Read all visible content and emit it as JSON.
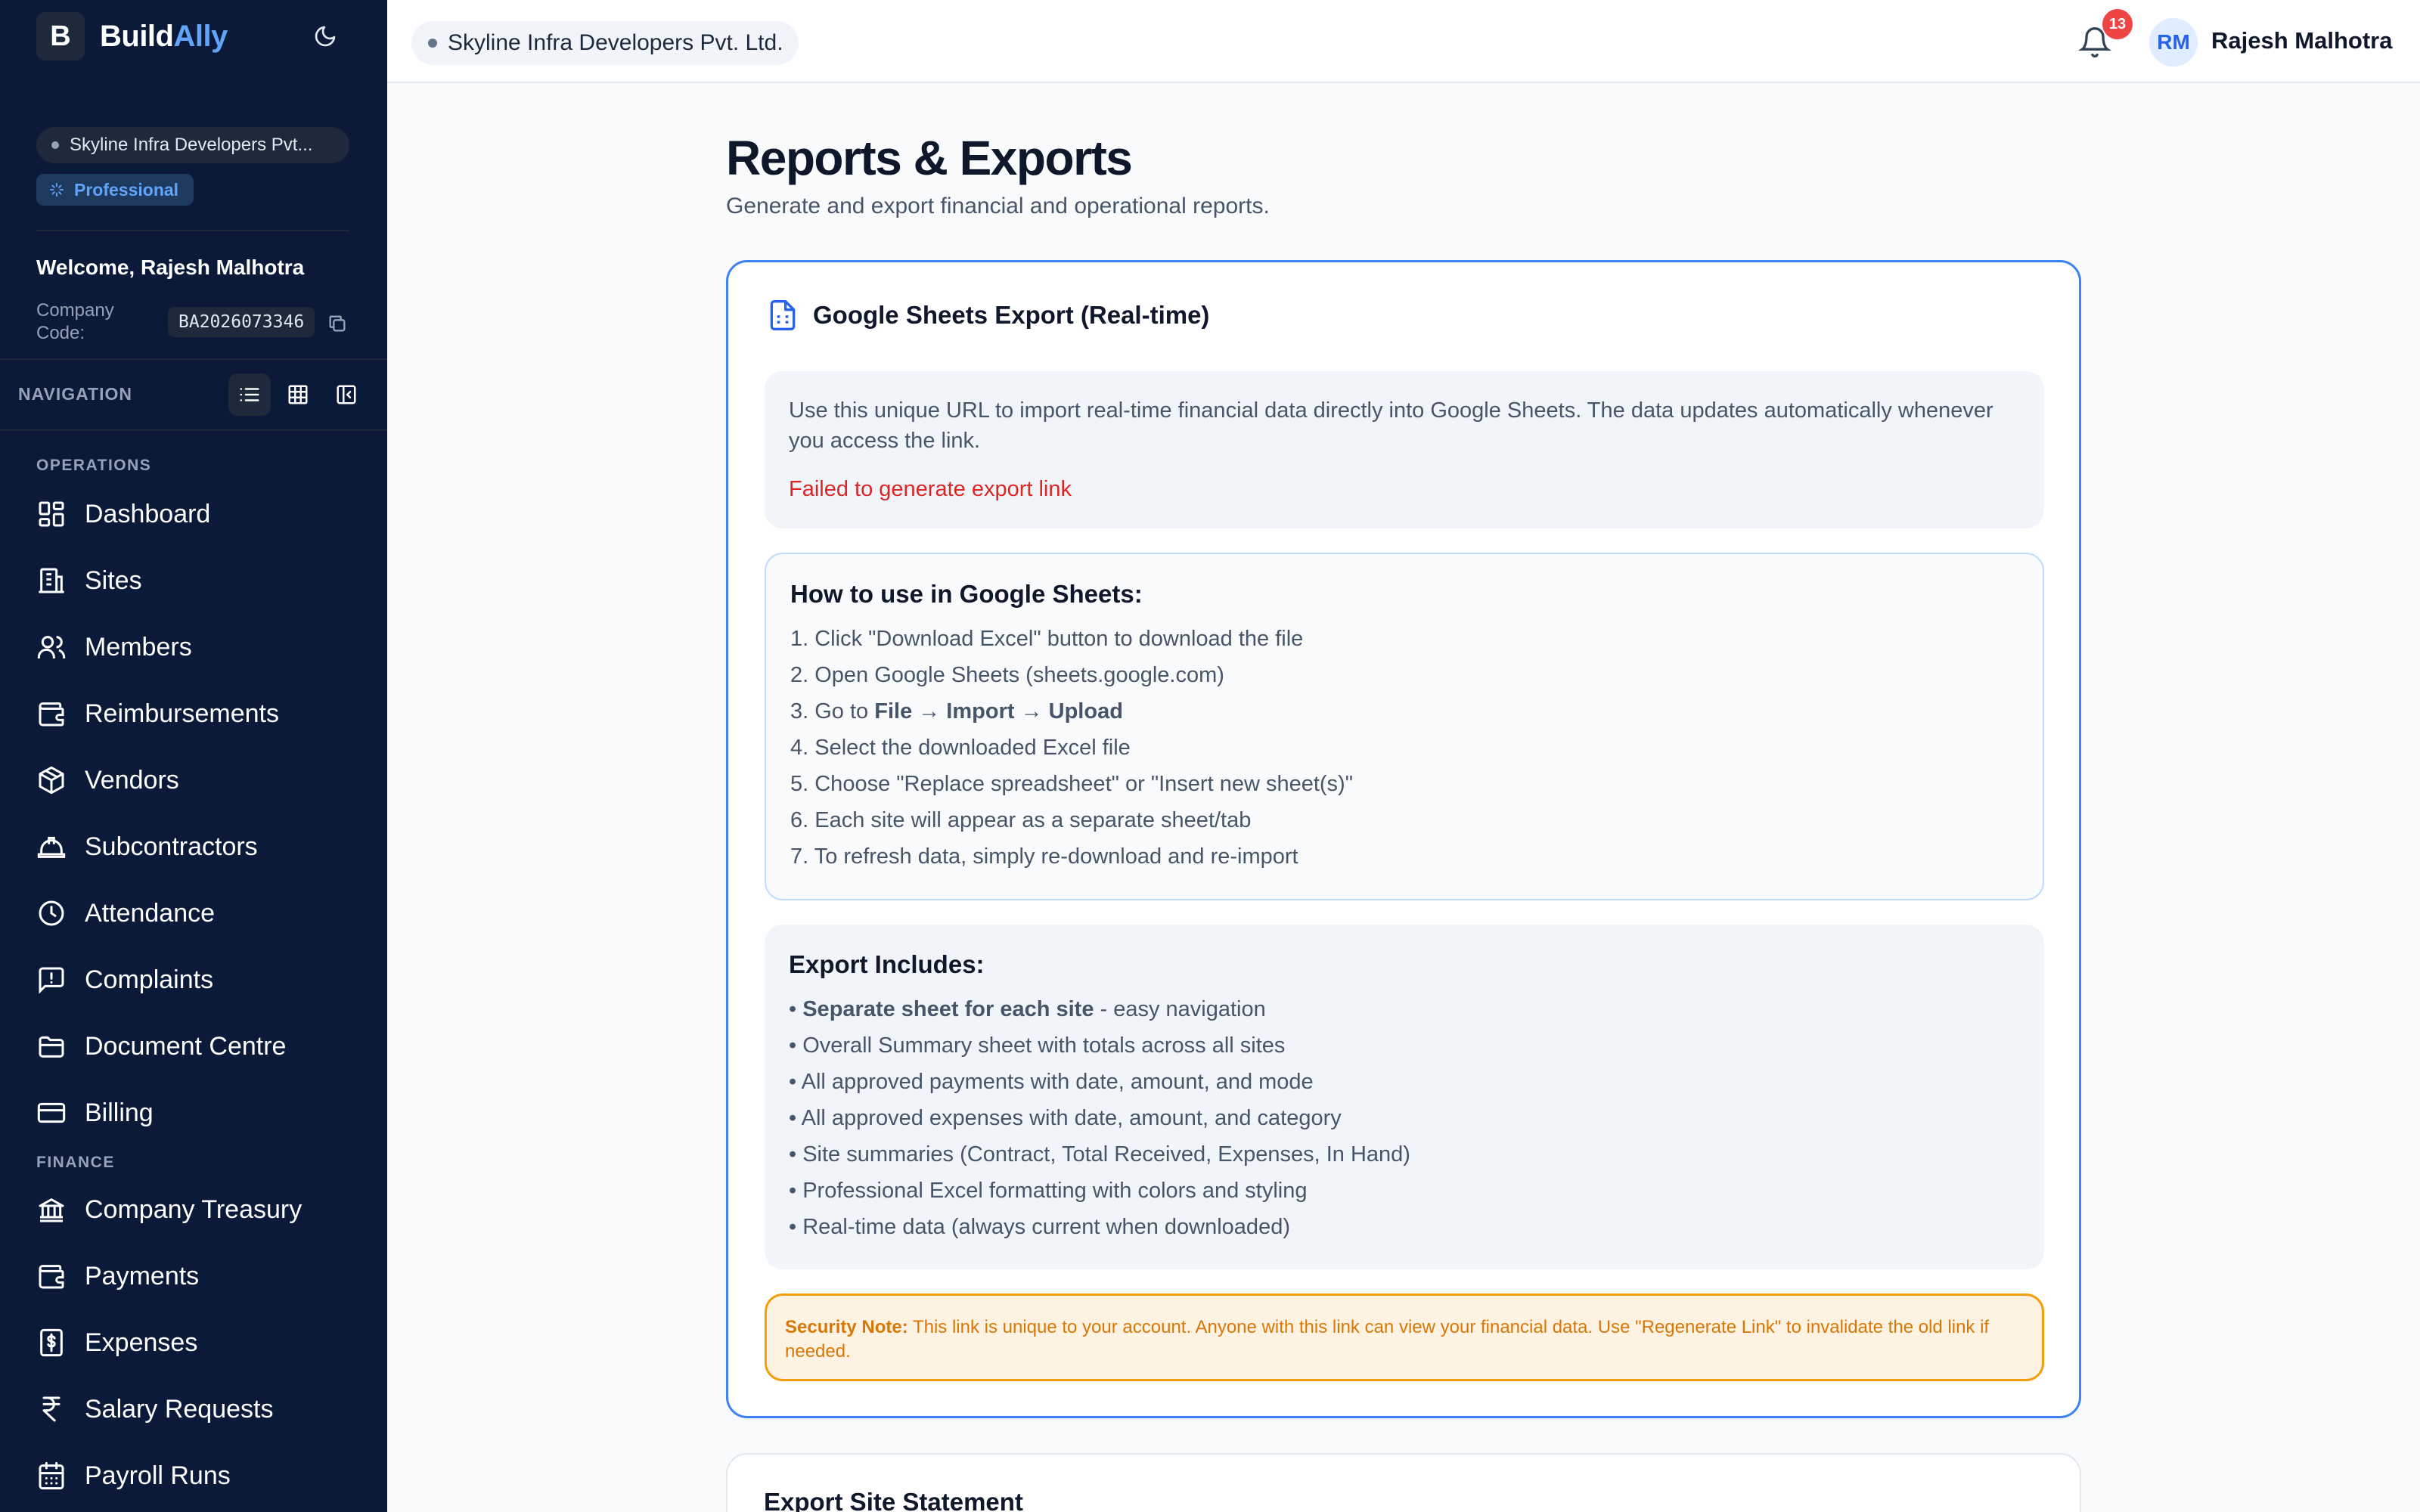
{
  "app": {
    "name_part1": "Build",
    "name_part2": "Ally",
    "logo_letter": "B"
  },
  "sidebar": {
    "org_name": "Skyline Infra Developers Pvt...",
    "plan": "Professional",
    "welcome": "Welcome, Rajesh Malhotra",
    "company_code_label": "Company Code:",
    "company_code": "BA2026073346",
    "nav_label": "NAVIGATION",
    "sections": [
      {
        "title": "OPERATIONS",
        "items": [
          {
            "label": "Dashboard",
            "icon": "dashboard-icon"
          },
          {
            "label": "Sites",
            "icon": "building-icon"
          },
          {
            "label": "Members",
            "icon": "users-icon"
          },
          {
            "label": "Reimbursements",
            "icon": "wallet-icon"
          },
          {
            "label": "Vendors",
            "icon": "box-icon"
          },
          {
            "label": "Subcontractors",
            "icon": "hardhat-icon"
          },
          {
            "label": "Attendance",
            "icon": "clock-icon"
          },
          {
            "label": "Complaints",
            "icon": "message-alert-icon"
          },
          {
            "label": "Document Centre",
            "icon": "folder-icon"
          },
          {
            "label": "Billing",
            "icon": "credit-card-icon"
          }
        ]
      },
      {
        "title": "FINANCE",
        "items": [
          {
            "label": "Company Treasury",
            "icon": "bank-icon"
          },
          {
            "label": "Payments",
            "icon": "wallet-icon"
          },
          {
            "label": "Expenses",
            "icon": "receipt-dollar-icon"
          },
          {
            "label": "Salary Requests",
            "icon": "rupee-icon"
          },
          {
            "label": "Payroll Runs",
            "icon": "calendar-icon"
          }
        ]
      }
    ]
  },
  "topbar": {
    "org_name": "Skyline Infra Developers Pvt. Ltd.",
    "notification_count": "13",
    "user_initials": "RM",
    "user_name": "Rajesh Malhotra"
  },
  "page": {
    "title": "Reports & Exports",
    "subtitle": "Generate and export financial and operational reports."
  },
  "sheets_card": {
    "title": "Google Sheets Export (Real-time)",
    "info": "Use this unique URL to import real-time financial data directly into Google Sheets. The data updates automatically whenever you access the link.",
    "error": "Failed to generate export link",
    "how_title": "How to use in Google Sheets:",
    "how_steps": {
      "s1": "1. Click \"Download Excel\" button to download the file",
      "s2": "2. Open Google Sheets (sheets.google.com)",
      "s3_prefix": "3. Go to ",
      "s3_bold": "File → Import → Upload",
      "s4": "4. Select the downloaded Excel file",
      "s5": "5. Choose \"Replace spreadsheet\" or \"Insert new sheet(s)\"",
      "s6": "6. Each site will appear as a separate sheet/tab",
      "s7": "7. To refresh data, simply re-download and re-import"
    },
    "includes_title": "Export Includes:",
    "includes": {
      "i1_prefix": "• ",
      "i1_bold": "Separate sheet for each site",
      "i1_suffix": " - easy navigation",
      "i2": "• Overall Summary sheet with totals across all sites",
      "i3": "• All approved payments with date, amount, and mode",
      "i4": "• All approved expenses with date, amount, and category",
      "i5": "• Site summaries (Contract, Total Received, Expenses, In Hand)",
      "i6": "• Professional Excel formatting with colors and styling",
      "i7": "• Real-time data (always current when downloaded)"
    },
    "security_label": "Security Note:",
    "security_text": " This link is unique to your account. Anyone with this link can view your financial data. Use \"Regenerate Link\" to invalidate the old link if needed."
  },
  "statement_card": {
    "title": "Export Site Statement"
  },
  "colors": {
    "sidebar_bg": "#0c1a3a",
    "accent": "#3b82f6",
    "error": "#dc2626",
    "warning": "#d97706"
  }
}
